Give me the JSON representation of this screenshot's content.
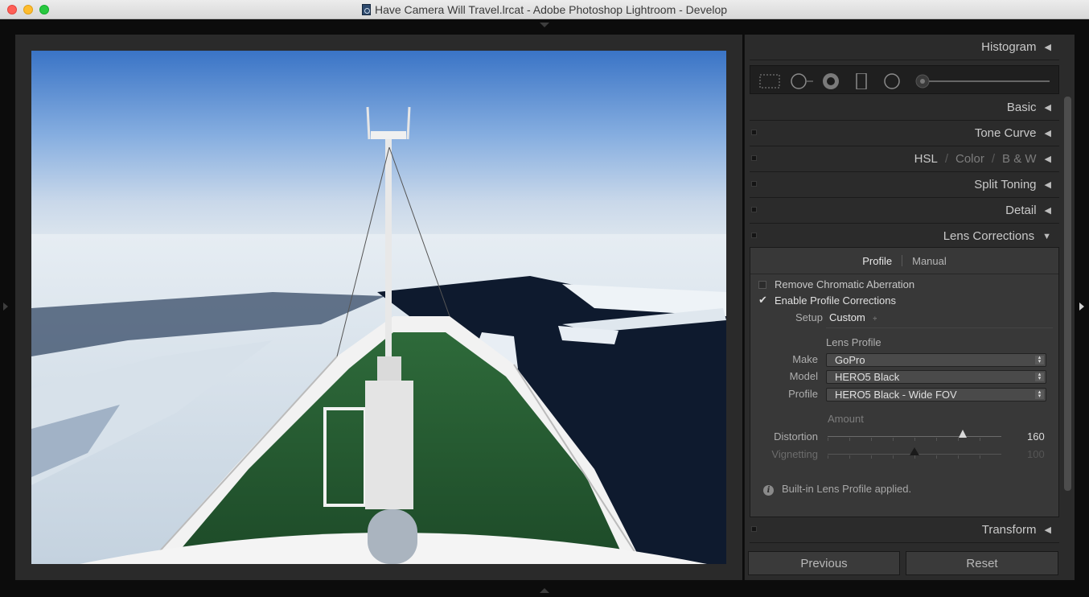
{
  "window": {
    "title": "Have Camera Will Travel.lrcat - Adobe Photoshop Lightroom - Develop"
  },
  "panel": {
    "histogram": "Histogram",
    "basic": "Basic",
    "tone_curve": "Tone Curve",
    "hsl": {
      "label": "HSL",
      "color": "Color",
      "bw": "B & W",
      "sep": "/"
    },
    "split_toning": "Split Toning",
    "detail": "Detail",
    "lens_corrections": {
      "title": "Lens Corrections",
      "tabs": [
        "Profile",
        "Manual"
      ],
      "remove_ca": "Remove Chromatic Aberration",
      "enable_profile": "Enable Profile Corrections",
      "setup_label": "Setup",
      "setup_value": "Custom",
      "lens_profile_heading": "Lens Profile",
      "make_label": "Make",
      "make_value": "GoPro",
      "model_label": "Model",
      "model_value": "HERO5 Black",
      "profile_label": "Profile",
      "profile_value": "HERO5 Black - Wide FOV",
      "amount_heading": "Amount",
      "distortion_label": "Distortion",
      "distortion_value": "160",
      "vignetting_label": "Vignetting",
      "vignetting_value": "100",
      "info_text": "Built-in Lens Profile applied."
    },
    "transform": "Transform",
    "previous_button": "Previous",
    "reset_button": "Reset"
  },
  "sliders": {
    "distortion_fraction": 0.78,
    "vignetting_fraction": 0.5
  },
  "colors": {
    "panel_bg": "#2b2b2b",
    "title_text": "#3a3a3a",
    "panel_text": "#c9c9c9"
  }
}
